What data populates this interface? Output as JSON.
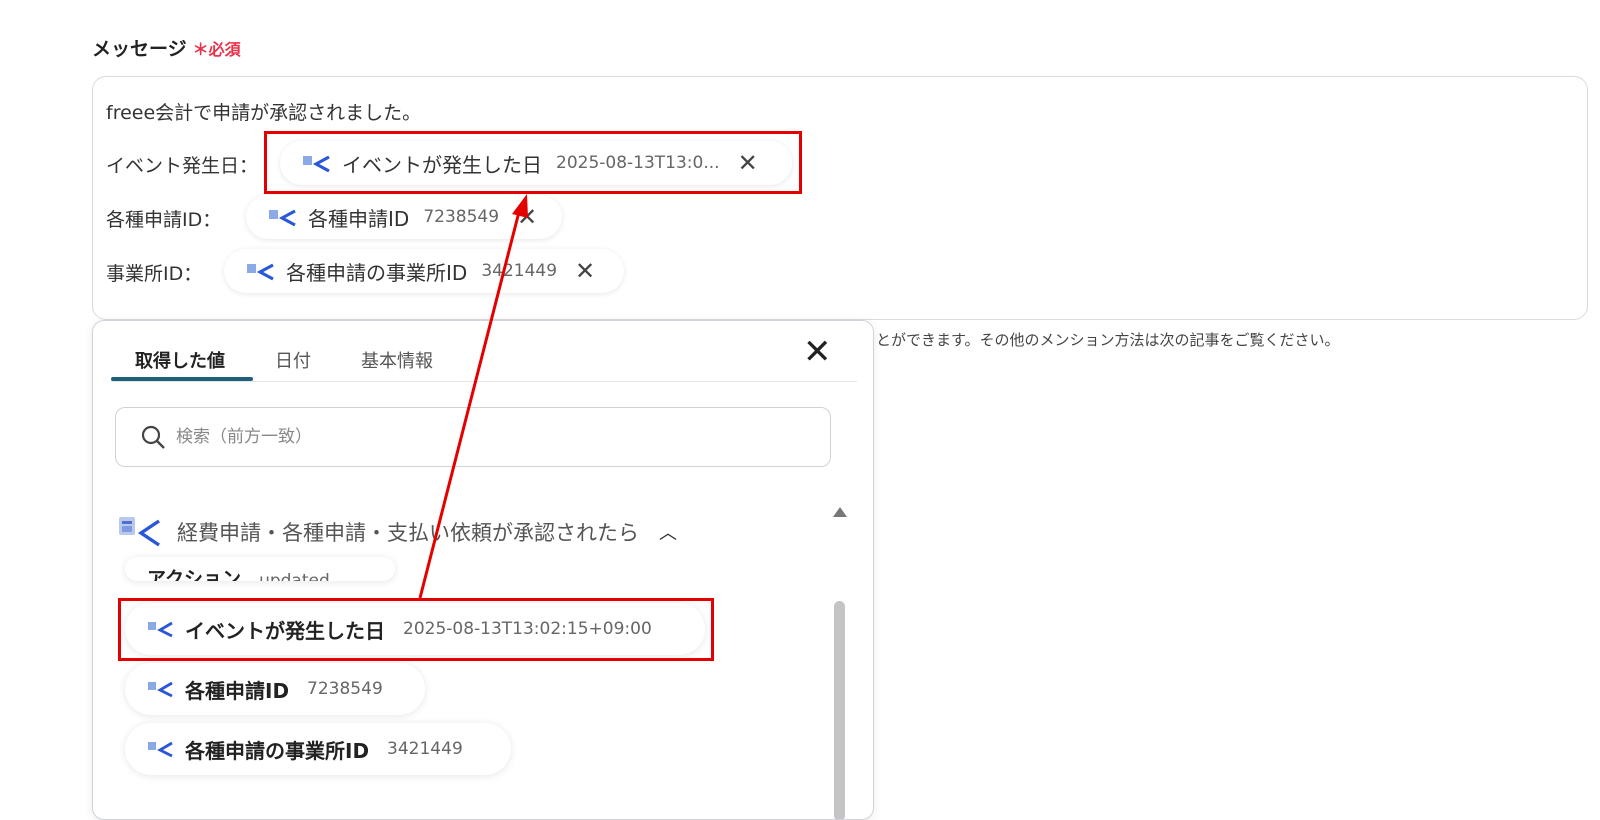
{
  "field": {
    "label": "メッセージ",
    "required_mark": "＊",
    "required_text": "必須"
  },
  "message": {
    "line1": "freee会計で申請が承認されました。",
    "line2_label": "イベント発生日：",
    "line3_label": "各種申請ID：",
    "line4_label": "事業所ID：",
    "chips": [
      {
        "name": "イベントが発生した日",
        "value": "2025-08-13T13:0...",
        "icon": "freee-app-icon",
        "remove_icon": "close-icon"
      },
      {
        "name": "各種申請ID",
        "value": "7238549",
        "icon": "freee-app-icon",
        "remove_icon": "close-icon"
      },
      {
        "name": "各種申請の事業所ID",
        "value": "3421449",
        "icon": "freee-app-icon",
        "remove_icon": "close-icon"
      }
    ]
  },
  "hint": "とができます。その他のメンション方法は次の記事をご覧ください。",
  "panel": {
    "tabs": [
      "取得した値",
      "日付",
      "基本情報"
    ],
    "active_tab": "取得した値",
    "close_icon": "close-icon",
    "search_placeholder": "検索（前方一致）",
    "group_title": "経費申請・各種申請・支払い依頼が承認されたら",
    "group_icon": "freee-app-icon",
    "partial_item": {
      "name": "アクション",
      "value": "updated"
    },
    "items": [
      {
        "name": "イベントが発生した日",
        "value": "2025-08-13T13:02:15+09:00"
      },
      {
        "name": "各種申請ID",
        "value": "7238549"
      },
      {
        "name": "各種申請の事業所ID",
        "value": "3421449"
      }
    ]
  },
  "colors": {
    "highlight": "#e50000",
    "accent_tab": "#1e5f7a",
    "required": "#e8334a"
  }
}
